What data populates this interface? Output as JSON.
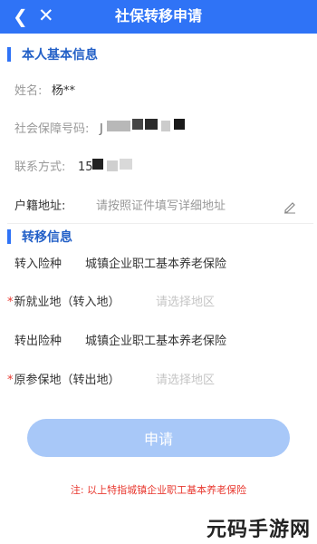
{
  "header": {
    "title": "社保转移申请",
    "back_icon": "back-arrow-icon",
    "close_icon": "close-icon"
  },
  "basic_info": {
    "section_title": "本人基本信息",
    "name_label": "姓名:",
    "name_value": "杨**",
    "ssn_label": "社会保障号码:",
    "ssn_value_prefix": "J",
    "phone_label": "联系方式:",
    "phone_value_prefix": "15",
    "address_label": "户籍地址:",
    "address_placeholder": "请按照证件填写详细地址"
  },
  "transfer_info": {
    "section_title": "转移信息",
    "in_type_label": "转入险种",
    "in_type_value": "城镇企业职工基本养老保险",
    "new_location_label": "新就业地（转入地）",
    "new_location_placeholder": "请选择地区",
    "out_type_label": "转出险种",
    "out_type_value": "城镇企业职工基本养老保险",
    "orig_location_label": "原参保地（转出地）",
    "orig_location_placeholder": "请选择地区",
    "required_mark": "*"
  },
  "actions": {
    "apply_label": "申请"
  },
  "note": "注:  以上特指城镇企业职工基本养老保险",
  "watermark": "元码手游网",
  "colors": {
    "header_bg": "#2f73f6",
    "section_accent": "#2360c7",
    "button_bg": "#a8c8f8",
    "required": "#e8382f"
  }
}
